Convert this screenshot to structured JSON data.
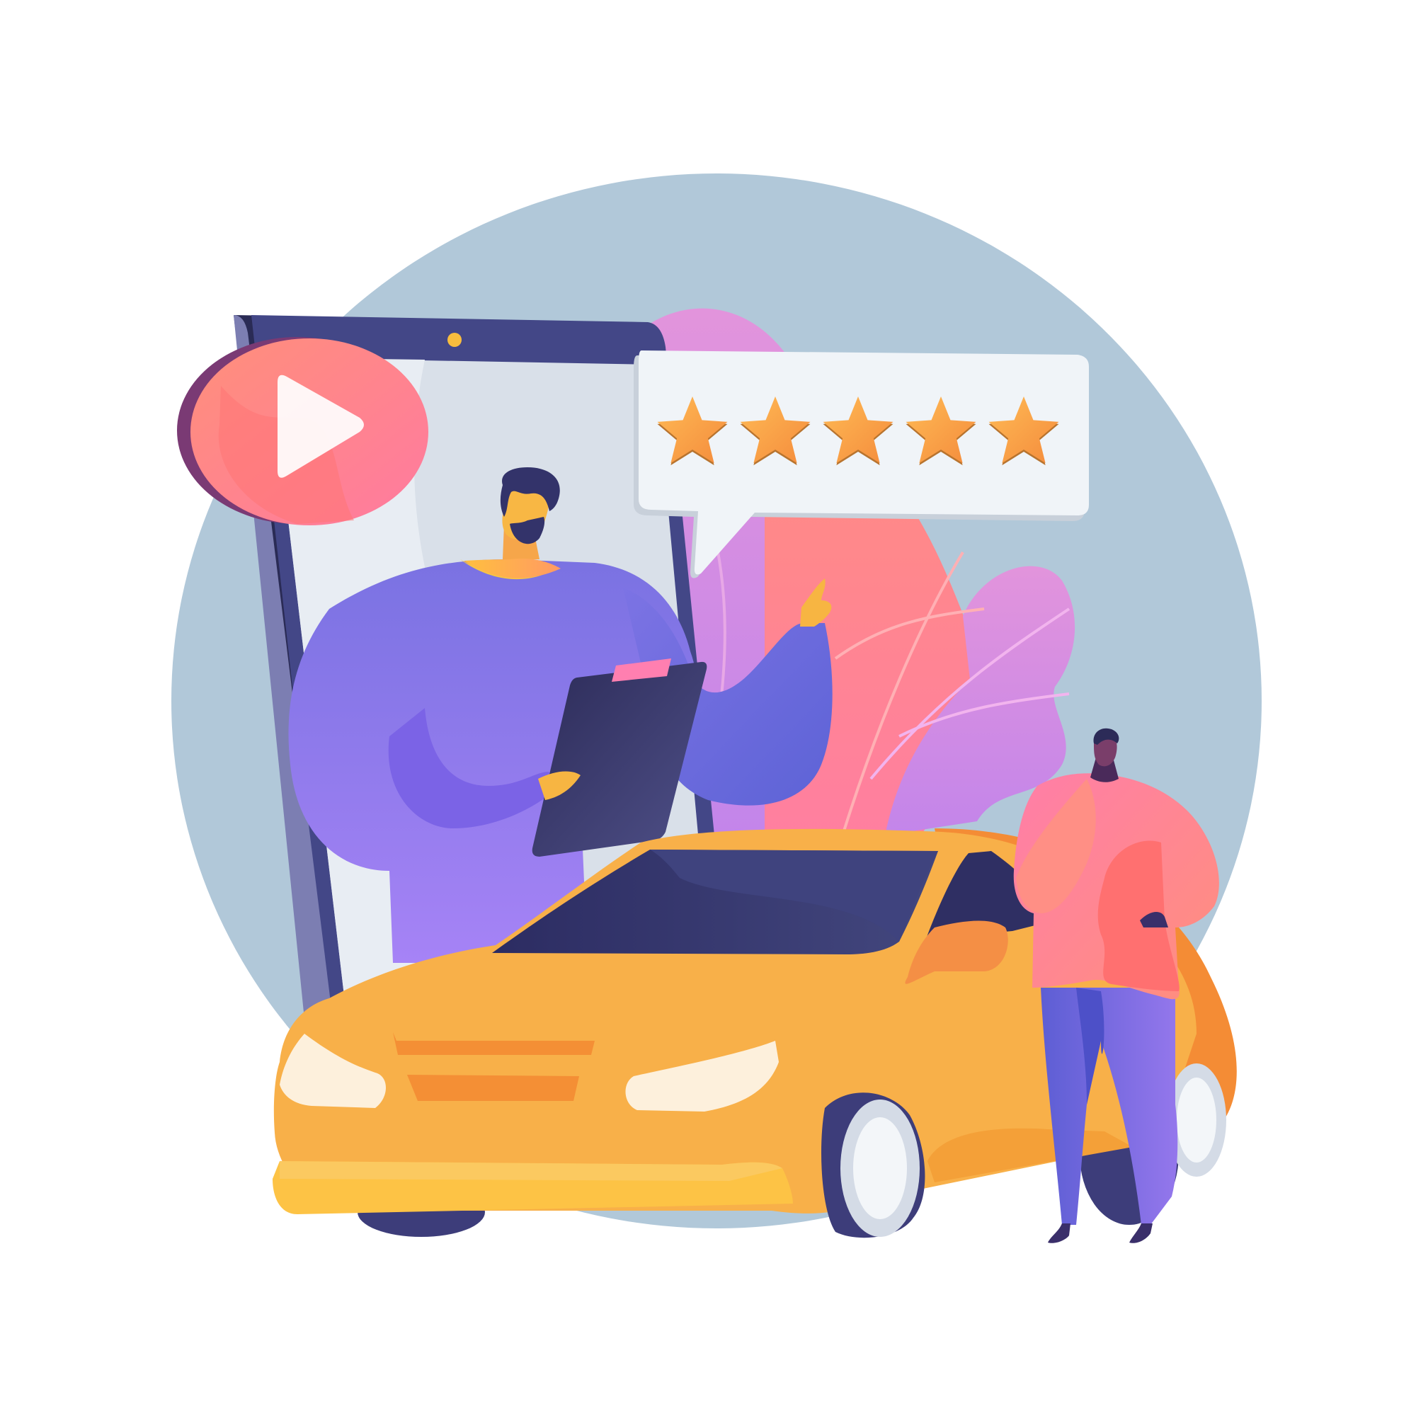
{
  "rating": {
    "value": 5,
    "max": 5
  },
  "icons": {
    "video": "play-icon",
    "rating": "star-icon"
  },
  "colors": {
    "background": "#ffffff",
    "backdrop_circle": "#b1c8d9",
    "phone_frame": "#434787",
    "phone_screen": "#d9e0e9",
    "play_button": "#ff7d7d",
    "rating_bubble": "#f0f4f8",
    "star": "#f8a94a",
    "car_body": "#f8b049",
    "car_window": "#2f2f63",
    "instructor_shirt": "#8677e8",
    "student_shirt": "#ff8a85",
    "plant_pink": "#dd8ed9",
    "plant_coral": "#ff8a8f"
  }
}
